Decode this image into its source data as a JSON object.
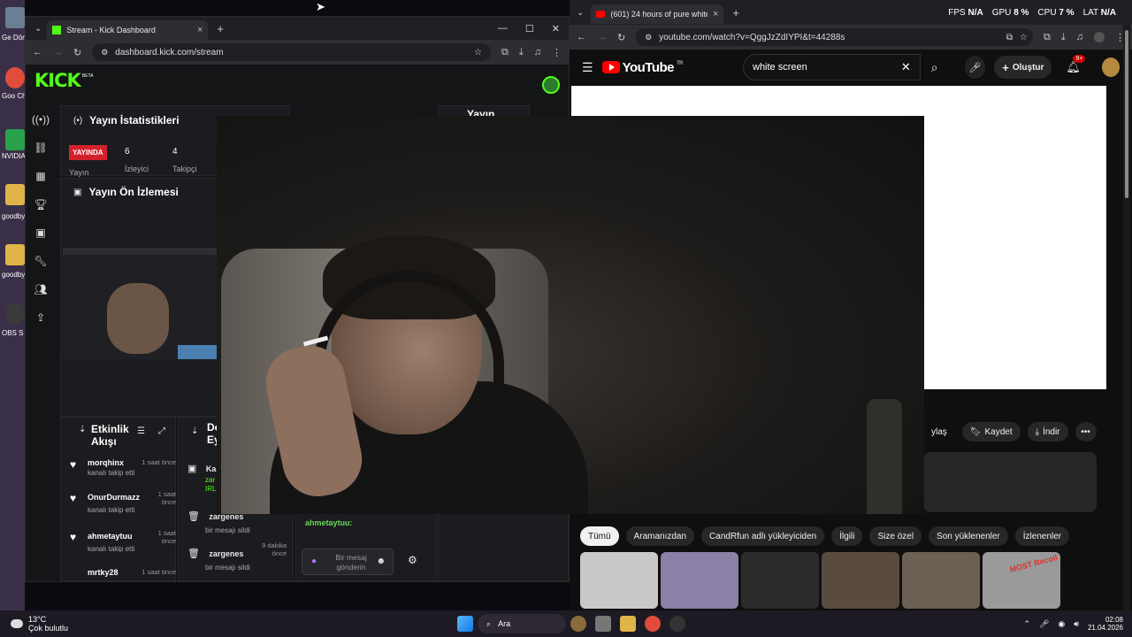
{
  "desktop": {
    "icons": [
      {
        "label": "Ge Dönü",
        "color": "#6b7f94"
      },
      {
        "label": "Goo Chro",
        "color": "#e24c3b"
      },
      {
        "label": "NVIDIA",
        "color": "#2aa14b"
      },
      {
        "label": "goodby",
        "color": "#e0b449"
      },
      {
        "label": "goodby",
        "color": "#e0b449"
      },
      {
        "label": "OBS S",
        "color": "#3a3a3a"
      }
    ]
  },
  "kick_window": {
    "tab_title": "Stream - Kick Dashboard",
    "url": "dashboard.kick.com/stream",
    "logo": "KICK",
    "logo_beta": "BETA",
    "stats_panel": {
      "title": "Yayın İstatistikleri",
      "live_badge": "YAYINDA",
      "live_sub": "Yayın",
      "viewers_value": "6",
      "viewers_label": "İzleyici",
      "followers_value": "4",
      "followers_label": "Takipçi"
    },
    "preview_panel": {
      "title": "Yayın Ön İzlemesi"
    },
    "third_panel_title": "Yayın",
    "activity_panel": {
      "title_line1": "Etkinlik",
      "title_line2": "Akışı",
      "items": [
        {
          "user": "morqhinx",
          "time": "1 saat önce",
          "action": "kanalı takip etti"
        },
        {
          "user": "OnurDurmazz",
          "time": "1 saat önce",
          "action": "kanalı takip etti"
        },
        {
          "user": "ahmetaytuu",
          "time": "1 saat önce",
          "action": "kanalı takip etti"
        },
        {
          "user": "mrtky28",
          "time": "1 saat önce",
          "action": ""
        }
      ]
    },
    "events_panel": {
      "title_line1": "De",
      "title_line2": "Ey",
      "items": [
        {
          "user": "Ka",
          "extra": "zar IRL",
          "time": "",
          "action": ""
        },
        {
          "user": "zargenes",
          "time": "önce",
          "action": "bir mesajı sildi"
        },
        {
          "user": "zargenes",
          "time": "9 dakika önce",
          "action": "bir mesajı sildi"
        }
      ]
    },
    "chat": {
      "last_user": "ahmetaytuu:",
      "input_placeholder": "Bir mesaj gönderin"
    }
  },
  "youtube_window": {
    "tab_title": "(601) 24 hours of pure white sc",
    "url": "youtube.com/watch?v=QggJzZdIYPI&t=44288s",
    "perf": {
      "fps_label": "FPS",
      "fps": "N/A",
      "gpu_label": "GPU",
      "gpu": "8 %",
      "cpu_label": "CPU",
      "cpu": "7 %",
      "lat_label": "LAT",
      "lat": "N/A"
    },
    "logo": "YouTube",
    "logo_region": "TR",
    "search_value": "white screen",
    "create_label": "Oluştur",
    "notif_count": "9+",
    "actions": [
      "ylaş",
      "Kaydet",
      "İndir",
      "•••"
    ],
    "chips": [
      "Tümü",
      "Aramanızdan",
      "CandRfun adlı yükleyiciden",
      "İlgili",
      "Size özel",
      "Son yüklenenler",
      "İzlenenler"
    ],
    "thumbnails": [
      {
        "color": "#c9c9c9"
      },
      {
        "color": "#8b80a6"
      },
      {
        "color": "#2b2b2b"
      },
      {
        "color": "#5a4b3f"
      },
      {
        "color": "#6a6054"
      },
      {
        "color": "#9a9a9a",
        "text": "MOST Recoil"
      }
    ]
  },
  "taskbar": {
    "weather_temp": "13°C",
    "weather_desc": "Çok bulutlu",
    "search_label": "Ara",
    "time": "02:08",
    "date": "21.04.2026"
  }
}
